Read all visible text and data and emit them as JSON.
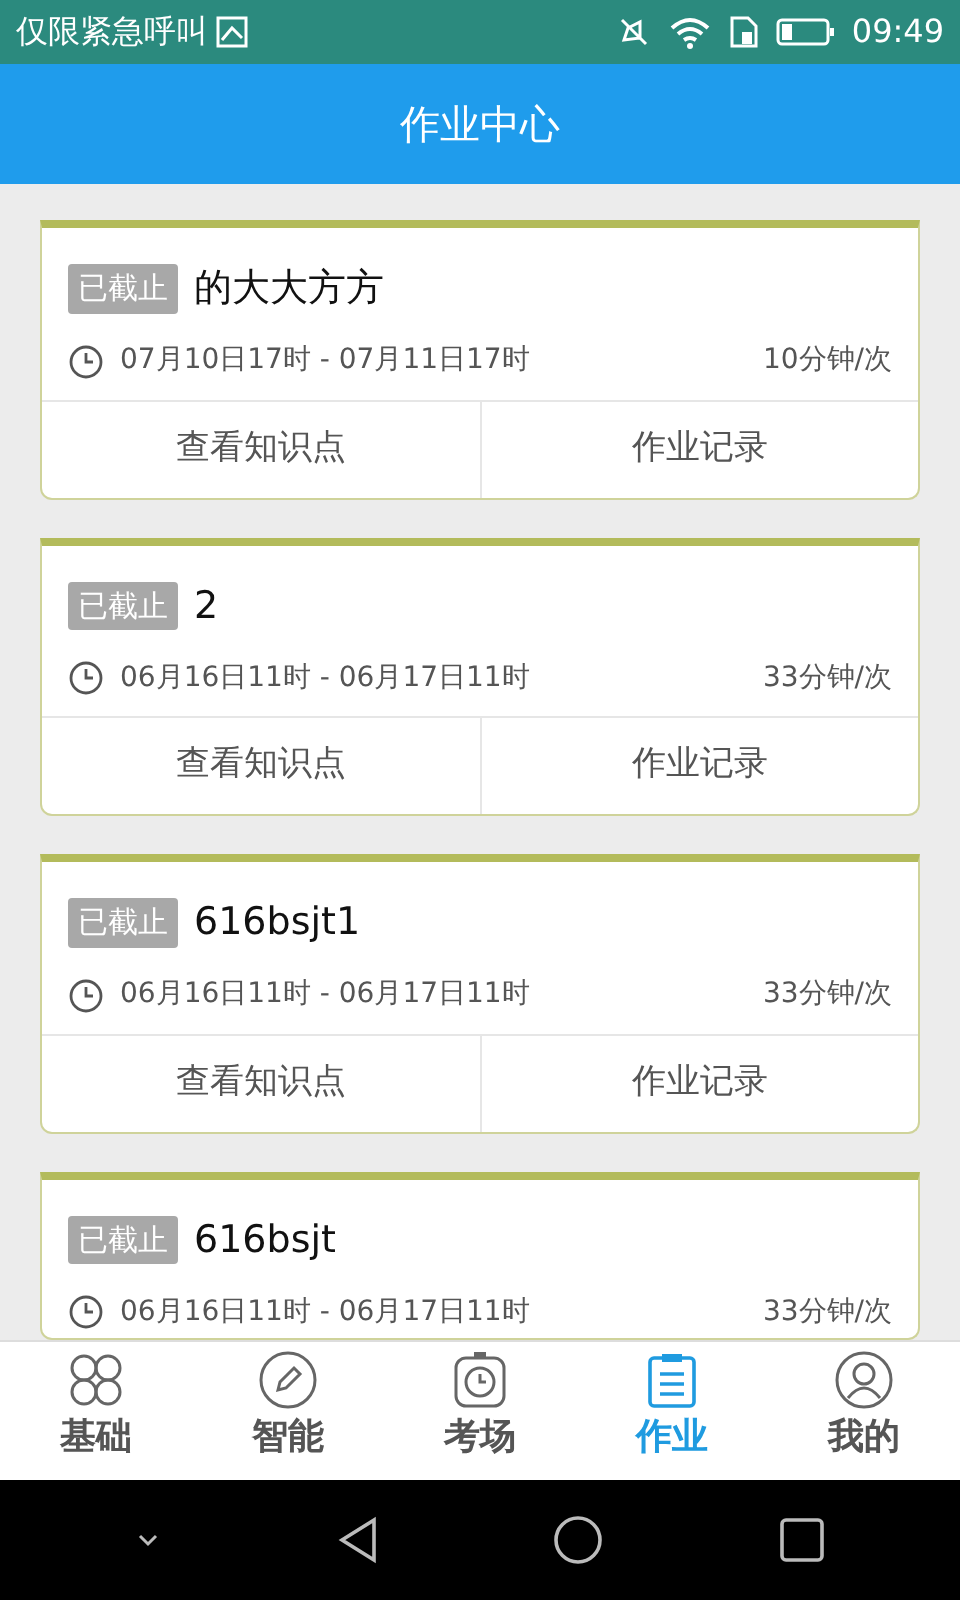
{
  "status_bar": {
    "carrier": "仅限紧急呼叫",
    "time": "09:49"
  },
  "header": {
    "title": "作业中心"
  },
  "assignments": [
    {
      "status": "已截止",
      "title": "的大大方方",
      "time_range": "07月10日17时 - 07月11日17时",
      "duration": "10分钟/次",
      "actions": [
        "查看知识点",
        "作业记录"
      ]
    },
    {
      "status": "已截止",
      "title": "2",
      "time_range": "06月16日11时 - 06月17日11时",
      "duration": "33分钟/次",
      "actions": [
        "查看知识点",
        "作业记录"
      ]
    },
    {
      "status": "已截止",
      "title": "616bsjt1",
      "time_range": "06月16日11时 - 06月17日11时",
      "duration": "33分钟/次",
      "actions": [
        "查看知识点",
        "作业记录"
      ]
    },
    {
      "status": "已截止",
      "title": "616bsjt",
      "time_range": "06月16日11时 - 06月17日11时",
      "duration": "33分钟/次"
    }
  ],
  "tab_bar": [
    {
      "kind": "basics",
      "label": "基础",
      "selected": false
    },
    {
      "kind": "smart",
      "label": "智能",
      "selected": false
    },
    {
      "kind": "exam",
      "label": "考场",
      "selected": false
    },
    {
      "kind": "homework",
      "label": "作业",
      "selected": true
    },
    {
      "kind": "profile",
      "label": "我的",
      "selected": false
    }
  ]
}
